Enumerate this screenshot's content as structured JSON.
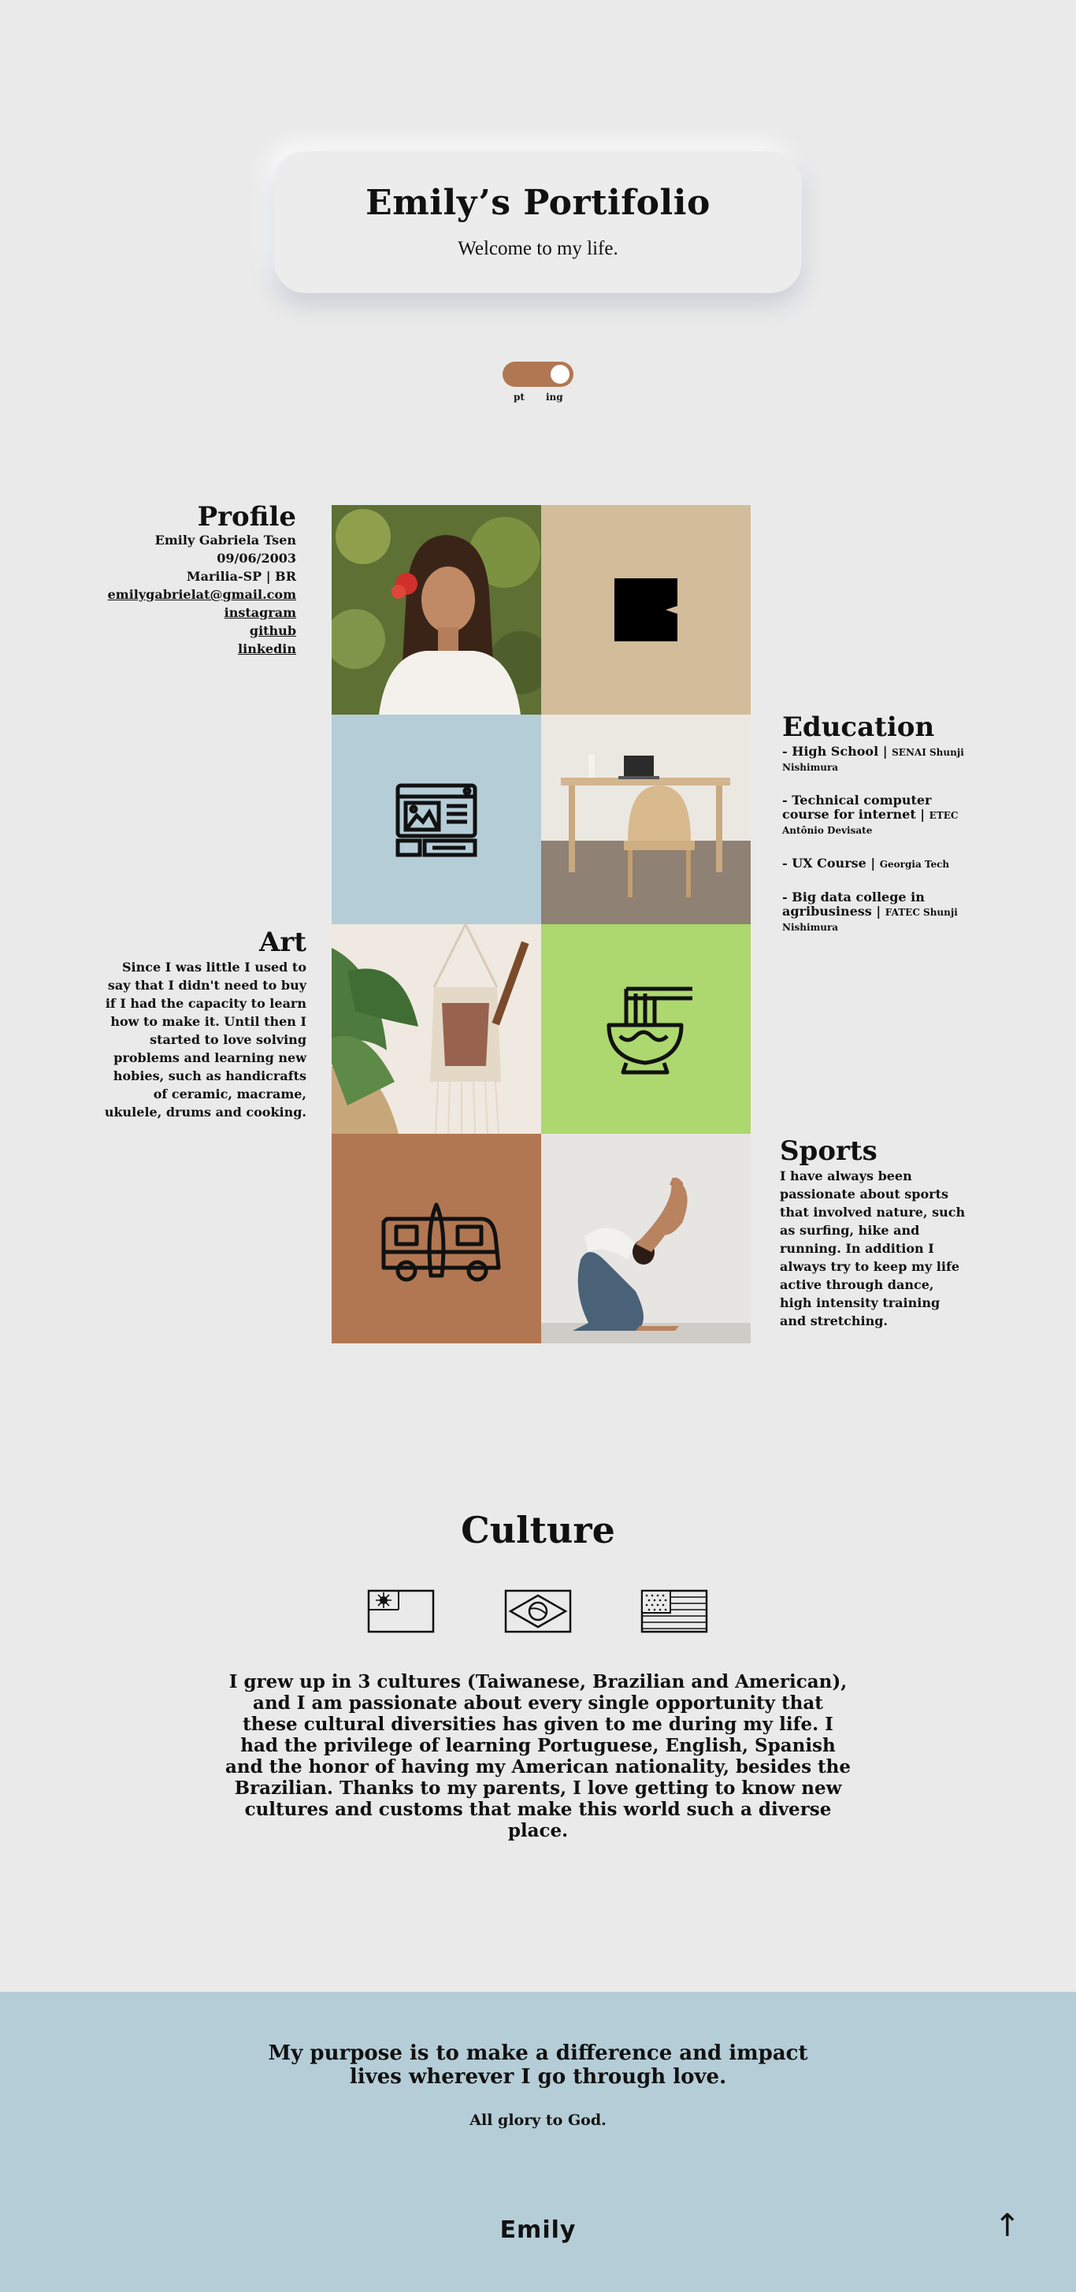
{
  "header": {
    "title": "Emily’s Portifolio",
    "subtitle": "Welcome to my life."
  },
  "language_toggle": {
    "left_label": "pt",
    "right_label": "ing",
    "active": "ing",
    "track_color": "#b17752"
  },
  "profile": {
    "title": "Profile",
    "name": "Emily Gabriela Tsen",
    "birth": "09/06/2003",
    "location": "Marilia-SP | BR",
    "email": "emilygabrielat@gmail.com",
    "links": [
      "instagram",
      "github",
      "linkedin"
    ]
  },
  "education": {
    "title": "Education",
    "items": [
      {
        "main": "- High School",
        "sep": " | ",
        "detail": "SENAI Shunji Nishimura"
      },
      {
        "main": "- Technical computer course for internet",
        "sep": " | ",
        "detail": "ETEC Antônio Devisate"
      },
      {
        "main": "- UX Course",
        "sep": " | ",
        "detail": "Georgia Tech"
      },
      {
        "main": "- Big data college in agribusiness",
        "sep": " | ",
        "detail": "FATEC Shunji Nishimura"
      }
    ]
  },
  "art": {
    "title": "Art",
    "text": "Since I was little I used to say that I didn't need to buy if I had the capacity to learn how to make it.  Until then I started to love solving problems and learning new hobies, such as handicrafts of ceramic, macrame, ukulele,  drums and cooking."
  },
  "sports": {
    "title": "Sports",
    "text": "I have always been passionate about sports that involved nature, such as surfing, hike and running. In addition I always try to keep my life active through dance, high intensity training and stretching."
  },
  "tiles": {
    "colors": {
      "tan": "#d2bc99",
      "blue": "#b5cdd7",
      "green": "#acd86f",
      "brown": "#b17752"
    },
    "icons": [
      "portrait-photo",
      "letter-e-logo-icon",
      "webpage-layout-icon",
      "desk-chair-photo",
      "macrame-ukulele-photo",
      "noodle-bowl-icon",
      "surf-van-icon",
      "yoga-pose-photo"
    ]
  },
  "culture": {
    "title": "Culture",
    "flags": [
      "taiwan-flag-icon",
      "brazil-flag-icon",
      "usa-flag-icon"
    ],
    "text": "I grew up in 3 cultures (Taiwanese, Brazilian and American), and I am passionate about every single opportunity that these cultural diversities has given to me during my life. I had the privilege of learning Portuguese, English, Spanish and the honor of having my American nationality, besides the Brazilian. Thanks to my parents, I love getting to know new cultures and customs that make this world such a diverse place."
  },
  "footer": {
    "purpose_line1": "My purpose is to make a difference and impact",
    "purpose_line2": "lives wherever I go through love.",
    "glory": "All glory to God.",
    "brand": "Emily",
    "up_arrow": "↑",
    "background": "#b5cdd7"
  }
}
